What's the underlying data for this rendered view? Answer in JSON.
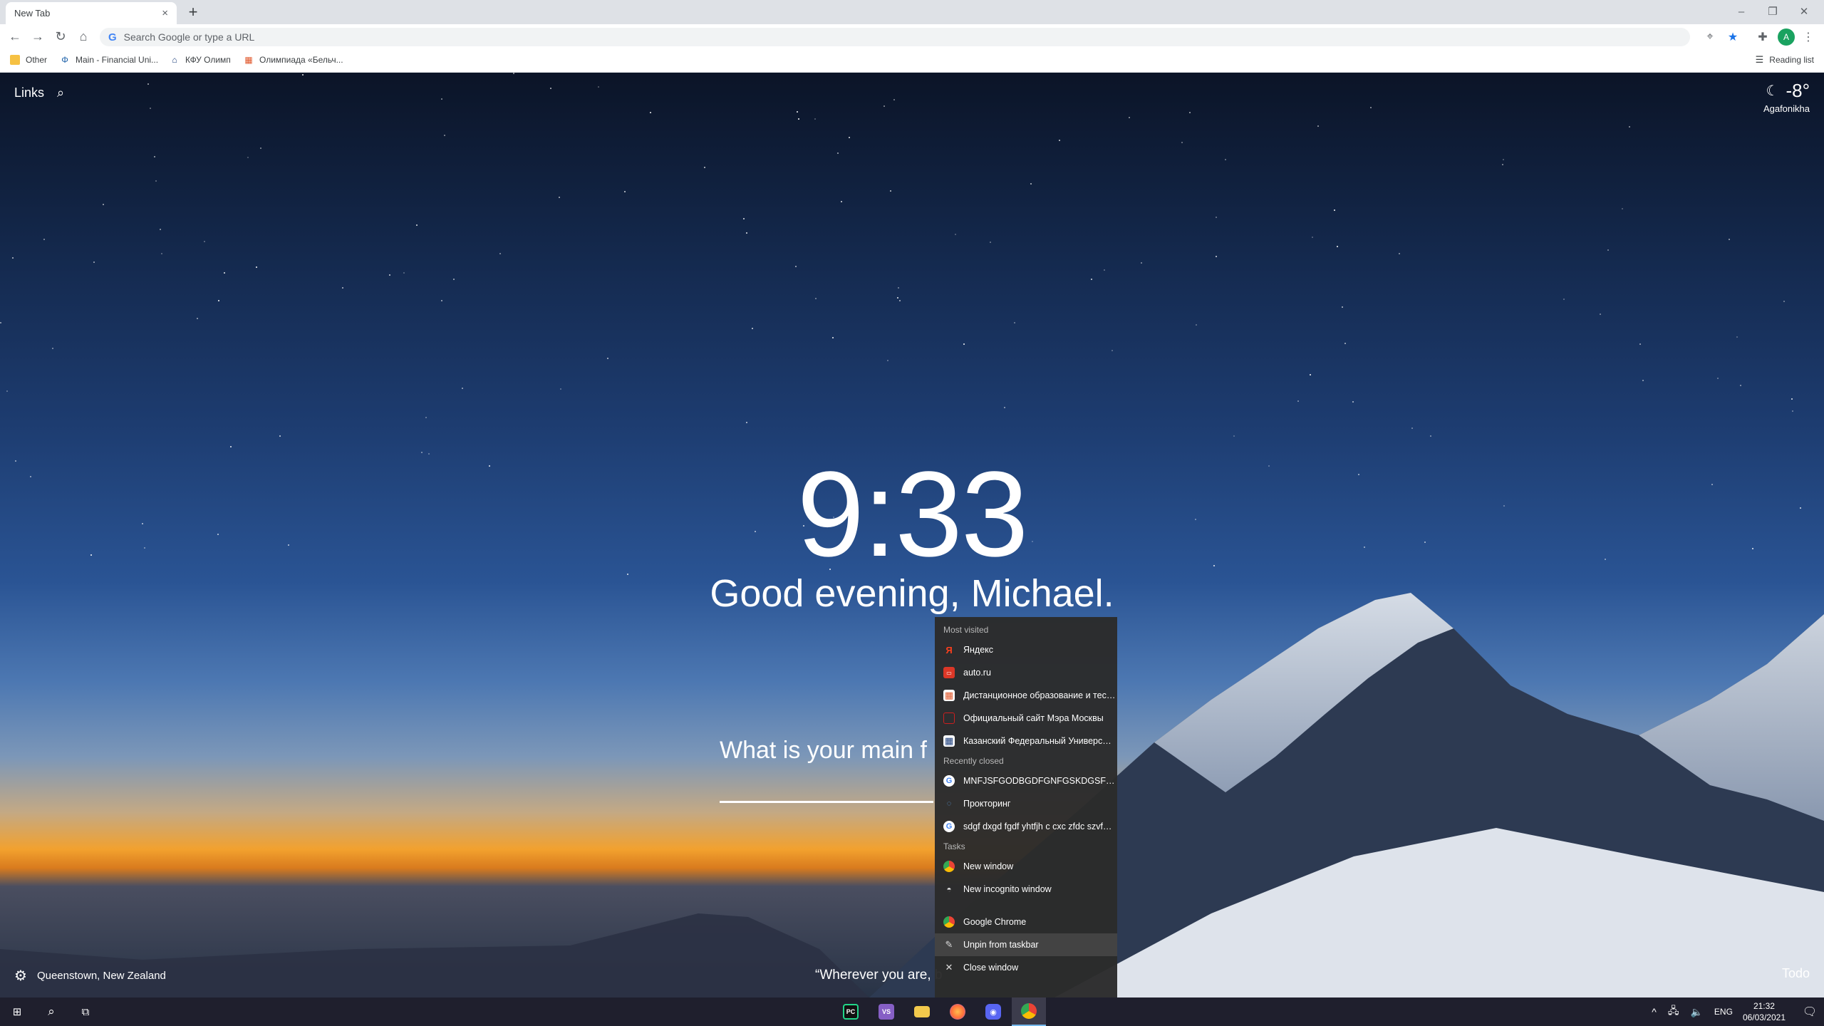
{
  "browser": {
    "tab_title": "New Tab",
    "tab_close": "×",
    "new_tab": "+",
    "window_controls": {
      "minimize": "–",
      "restore": "❐",
      "close": "✕"
    },
    "omnibox_placeholder": "Search Google or type a URL",
    "omnibox_g": "G",
    "profile_initial": "A",
    "bookmarks": [
      {
        "label": "Other",
        "icon": "folder-icon",
        "color": "#f6c143"
      },
      {
        "label": "Main - Financial Uni...",
        "icon": "phi-icon",
        "color": "#1a5fa8"
      },
      {
        "label": "КФУ Олимп",
        "icon": "building-icon",
        "color": "#1a3c7a"
      },
      {
        "label": "Олимпиада «Бельч...",
        "icon": "grid-icon",
        "color": "#e0562a"
      }
    ],
    "reading_list": "Reading list"
  },
  "ntp": {
    "links_label": "Links",
    "weather": {
      "temp": "-8°",
      "location": "Agafonikha"
    },
    "clock": "9:33",
    "greeting": "Good evening, Michael.",
    "focus_question": "What is your main f",
    "photo_location": "Queenstown, New Zealand",
    "quote": "“Wherever you are, b",
    "todo": "Todo"
  },
  "jumplist": {
    "most_visited_header": "Most visited",
    "most_visited": [
      {
        "label": "Яндекс",
        "icon": "yandex-icon",
        "glyph": "Я",
        "color": "#fc3f1d"
      },
      {
        "label": "auto.ru",
        "icon": "autoru-icon",
        "glyph": "▭",
        "color": "#db3727"
      },
      {
        "label": "Дистанционное образование и тести...",
        "icon": "grid-icon",
        "glyph": "▦",
        "color": "#e0562a"
      },
      {
        "label": "Официальный сайт Мэра Москвы",
        "icon": "moscow-icon",
        "glyph": "▢",
        "color": "#cc1f1f"
      },
      {
        "label": "Казанский Федеральный Университе...",
        "icon": "building-icon",
        "glyph": "▦",
        "color": "#ffffff"
      }
    ],
    "recently_closed_header": "Recently closed",
    "recently_closed": [
      {
        "label": "MNFJSFGODBGDFGNFGSKDGSFGSA -...",
        "icon": "google-icon",
        "glyph": "G"
      },
      {
        "label": "Прокторинг",
        "icon": "proctoring-icon",
        "glyph": "◌"
      },
      {
        "label": "sdgf dxgd fgdf yhtfjh c cxc zfdc szvfcfx...",
        "icon": "google-icon",
        "glyph": "G"
      }
    ],
    "tasks_header": "Tasks",
    "tasks": [
      {
        "label": "New window",
        "icon": "chrome-icon"
      },
      {
        "label": "New incognito window",
        "icon": "incognito-icon"
      }
    ],
    "app": [
      {
        "label": "Google Chrome",
        "icon": "chrome-icon"
      },
      {
        "label": "Unpin from taskbar",
        "icon": "unpin-icon"
      },
      {
        "label": "Close window",
        "icon": "close-icon"
      }
    ]
  },
  "taskbar": {
    "apps": [
      {
        "name": "pycharm",
        "glyph": "PC",
        "color": "#21d789"
      },
      {
        "name": "visual-studio",
        "glyph": "VS",
        "color": "#865fc5"
      },
      {
        "name": "file-explorer",
        "glyph": "▬",
        "color": "#f2c94c"
      },
      {
        "name": "firefox",
        "glyph": "●",
        "color": "#ff7139"
      },
      {
        "name": "discord",
        "glyph": "◉",
        "color": "#5865f2"
      },
      {
        "name": "chrome",
        "glyph": "◎",
        "color": "#34a853"
      }
    ],
    "lang": "ENG",
    "time": "21:32",
    "date": "06/03/2021"
  }
}
